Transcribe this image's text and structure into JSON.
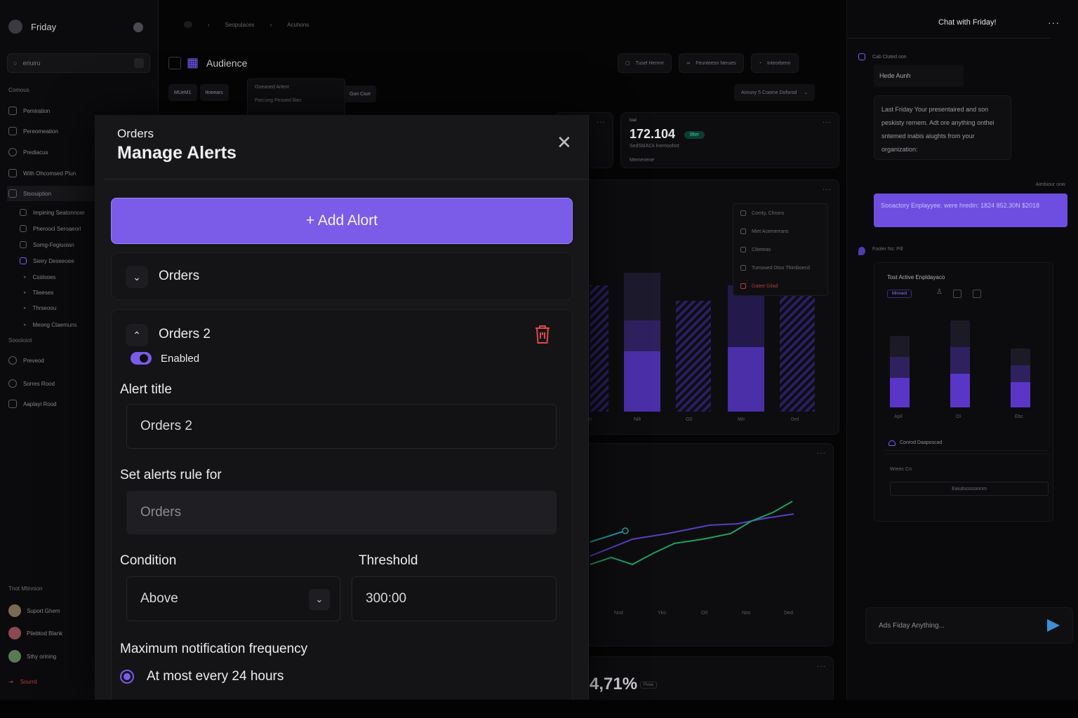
{
  "sidebar": {
    "app_name": "Friday",
    "search_placeholder": "eriuiru",
    "section1": "Comous",
    "items": [
      "Pemiration",
      "Pereomeation",
      "Prediacus",
      "With Ohcomsed Plun",
      "Stoouiption"
    ],
    "subitems": [
      "Impining Seatonnoer",
      "Pheroocl Seroaeorl",
      "Somg-Fegiuoian",
      "Sieiry Deseeoee"
    ],
    "subsub": [
      "Csslooes",
      "Tlieeses",
      "Thrseoou",
      "Meong Ctaemuns"
    ],
    "section2": "Soooloiot",
    "items2": [
      "Preveod",
      "Sorres Rood",
      "Aaplayi Rood"
    ],
    "section3": "Tnot Mtinnion",
    "users": [
      "Suport Ghem",
      "Piiebtod Blank",
      "Sthy orining"
    ],
    "logout": "Sourrd"
  },
  "topbar": {
    "crumbs": [
      "Seopulaces",
      "Acuhons"
    ],
    "page_title": "Audience",
    "buttons": [
      "Tusel Hermrr",
      "Feunteesn Nerues",
      "Inteorbenn"
    ],
    "filters": [
      "MUeM1",
      "Itneears"
    ],
    "menu": [
      "Ooeaned Arlent",
      "Parcung Pesoed lilan"
    ],
    "menu_partial": "Gon Ciurr",
    "sort": "Anruny 5 Coome Doforod"
  },
  "kpi": {
    "label": "toal",
    "value": "172.104",
    "badge": "lifter",
    "sub": "SedSblACk lnemoofort",
    "foot": "Memenene"
  },
  "context_menu": [
    "Comty, Chrons",
    "Miet Acemerrans",
    "Cliteteas",
    "Tumoued Otoo Thimboecd",
    "Gatee Gilad"
  ],
  "bar_axis": [
    "Nilt",
    "G0",
    "Mrr",
    "0ml"
  ],
  "line_axis": [
    "Nod",
    "Yko",
    "O0",
    "Nos",
    "Ded"
  ],
  "bottom_kpi": {
    "value": "4,71%",
    "badge": "Pusa"
  },
  "chat": {
    "title": "Chat with Friday!",
    "sender": "Cab Cluted oon",
    "pill": "Hede Aunh",
    "bot_message": "Last Friday Your presentaired and son peskisty rernem. Adt ore anything onthei sntemed inabis aiughts from your organization:",
    "time": "Aimbiour oow",
    "user_message": "Sooactory Enplayyee. were hredin: 1824  852.30N $2018",
    "bot_name": "Fooler Ns: Pill",
    "card_title": "Tost Active Enpldayaco",
    "card_tag": "Minnaot",
    "card_axis": [
      "Apil",
      "Oi",
      "Ebc"
    ],
    "card_row1": "Conrod Daaposcad",
    "card_row2": "Wreec Cn",
    "card_button": "Eaiutisosooonm",
    "input_placeholder": "Ads Fiday Anything..."
  },
  "modal": {
    "eyebrow": "Orders",
    "title": "Manage Alerts",
    "add_button": "+ Add Alort",
    "accordion1": "Orders",
    "accordion2": "Orders 2",
    "enabled_label": "Enabled",
    "enabled": true,
    "alert_title_label": "Alert title",
    "alert_title_value": "Orders 2",
    "rule_label": "Set alerts rule for",
    "rule_value": "Orders",
    "condition_label": "Condition",
    "condition_value": "Above",
    "threshold_label": "Threshold",
    "threshold_value": "300:00",
    "freq_label": "Maximum notification frequency",
    "freq_option": "At most every 24 hours"
  },
  "colors": {
    "accent": "#7a5ce8",
    "danger": "#e04848",
    "teal": "#2fd3a0"
  }
}
